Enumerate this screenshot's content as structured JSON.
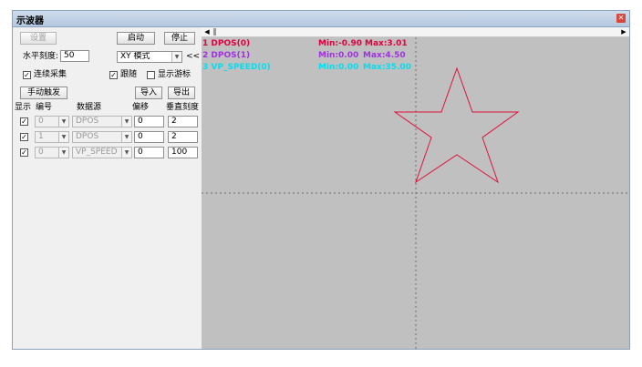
{
  "window": {
    "title": "示波器"
  },
  "toolbar": {
    "settings_label": "设置",
    "start_label": "启动",
    "stop_label": "停止",
    "horizontal_scale_label": "水平刻度:",
    "horizontal_scale_value": "50",
    "mode_value": "XY 模式",
    "collapse_label": "<<",
    "continuous_label": "连续采集",
    "follow_label": "跟随",
    "show_cursor_label": "显示游标",
    "manual_trigger_label": "手动触发",
    "import_label": "导入",
    "export_label": "导出"
  },
  "channels": {
    "headers": {
      "show": "显示",
      "number": "编号",
      "source": "数据源",
      "offset": "偏移",
      "vscale": "垂直刻度"
    },
    "rows": [
      {
        "number": "0",
        "source": "DPOS",
        "offset": "0",
        "vscale": "2",
        "checked": true
      },
      {
        "number": "1",
        "source": "DPOS",
        "offset": "0",
        "vscale": "2",
        "checked": true
      },
      {
        "number": "0",
        "source": "VP_SPEED",
        "offset": "0",
        "vscale": "100",
        "checked": true
      }
    ]
  },
  "scope": {
    "legend": [
      {
        "name": "1 DPOS(0)",
        "min": "Min:-0.90",
        "max": "Max:3.01",
        "color": "#e00040"
      },
      {
        "name": "2 DPOS(1)",
        "min": "Min:0.00",
        "max": "Max:4.50",
        "color": "#a030e0"
      },
      {
        "name": "3 VP_SPEED(0)",
        "min": "Min:0.00",
        "max": "Max:35.00",
        "color": "#00e0f0"
      }
    ],
    "trace_color": "#e0103a"
  }
}
